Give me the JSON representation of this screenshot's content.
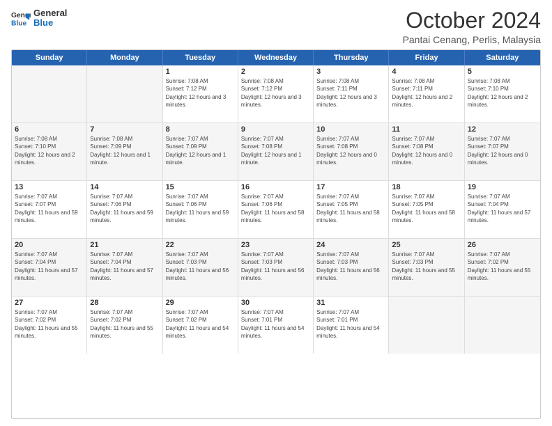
{
  "logo": {
    "general": "General",
    "blue": "Blue"
  },
  "title": "October 2024",
  "location": "Pantai Cenang, Perlis, Malaysia",
  "header_days": [
    "Sunday",
    "Monday",
    "Tuesday",
    "Wednesday",
    "Thursday",
    "Friday",
    "Saturday"
  ],
  "weeks": [
    [
      {
        "date": "",
        "info": ""
      },
      {
        "date": "",
        "info": ""
      },
      {
        "date": "1",
        "sunrise": "Sunrise: 7:08 AM",
        "sunset": "Sunset: 7:12 PM",
        "daylight": "Daylight: 12 hours and 3 minutes."
      },
      {
        "date": "2",
        "sunrise": "Sunrise: 7:08 AM",
        "sunset": "Sunset: 7:12 PM",
        "daylight": "Daylight: 12 hours and 3 minutes."
      },
      {
        "date": "3",
        "sunrise": "Sunrise: 7:08 AM",
        "sunset": "Sunset: 7:11 PM",
        "daylight": "Daylight: 12 hours and 3 minutes."
      },
      {
        "date": "4",
        "sunrise": "Sunrise: 7:08 AM",
        "sunset": "Sunset: 7:11 PM",
        "daylight": "Daylight: 12 hours and 2 minutes."
      },
      {
        "date": "5",
        "sunrise": "Sunrise: 7:08 AM",
        "sunset": "Sunset: 7:10 PM",
        "daylight": "Daylight: 12 hours and 2 minutes."
      }
    ],
    [
      {
        "date": "6",
        "sunrise": "Sunrise: 7:08 AM",
        "sunset": "Sunset: 7:10 PM",
        "daylight": "Daylight: 12 hours and 2 minutes."
      },
      {
        "date": "7",
        "sunrise": "Sunrise: 7:08 AM",
        "sunset": "Sunset: 7:09 PM",
        "daylight": "Daylight: 12 hours and 1 minute."
      },
      {
        "date": "8",
        "sunrise": "Sunrise: 7:07 AM",
        "sunset": "Sunset: 7:09 PM",
        "daylight": "Daylight: 12 hours and 1 minute."
      },
      {
        "date": "9",
        "sunrise": "Sunrise: 7:07 AM",
        "sunset": "Sunset: 7:08 PM",
        "daylight": "Daylight: 12 hours and 1 minute."
      },
      {
        "date": "10",
        "sunrise": "Sunrise: 7:07 AM",
        "sunset": "Sunset: 7:08 PM",
        "daylight": "Daylight: 12 hours and 0 minutes."
      },
      {
        "date": "11",
        "sunrise": "Sunrise: 7:07 AM",
        "sunset": "Sunset: 7:08 PM",
        "daylight": "Daylight: 12 hours and 0 minutes."
      },
      {
        "date": "12",
        "sunrise": "Sunrise: 7:07 AM",
        "sunset": "Sunset: 7:07 PM",
        "daylight": "Daylight: 12 hours and 0 minutes."
      }
    ],
    [
      {
        "date": "13",
        "sunrise": "Sunrise: 7:07 AM",
        "sunset": "Sunset: 7:07 PM",
        "daylight": "Daylight: 11 hours and 59 minutes."
      },
      {
        "date": "14",
        "sunrise": "Sunrise: 7:07 AM",
        "sunset": "Sunset: 7:06 PM",
        "daylight": "Daylight: 11 hours and 59 minutes."
      },
      {
        "date": "15",
        "sunrise": "Sunrise: 7:07 AM",
        "sunset": "Sunset: 7:06 PM",
        "daylight": "Daylight: 11 hours and 59 minutes."
      },
      {
        "date": "16",
        "sunrise": "Sunrise: 7:07 AM",
        "sunset": "Sunset: 7:06 PM",
        "daylight": "Daylight: 11 hours and 58 minutes."
      },
      {
        "date": "17",
        "sunrise": "Sunrise: 7:07 AM",
        "sunset": "Sunset: 7:05 PM",
        "daylight": "Daylight: 11 hours and 58 minutes."
      },
      {
        "date": "18",
        "sunrise": "Sunrise: 7:07 AM",
        "sunset": "Sunset: 7:05 PM",
        "daylight": "Daylight: 11 hours and 58 minutes."
      },
      {
        "date": "19",
        "sunrise": "Sunrise: 7:07 AM",
        "sunset": "Sunset: 7:04 PM",
        "daylight": "Daylight: 11 hours and 57 minutes."
      }
    ],
    [
      {
        "date": "20",
        "sunrise": "Sunrise: 7:07 AM",
        "sunset": "Sunset: 7:04 PM",
        "daylight": "Daylight: 11 hours and 57 minutes."
      },
      {
        "date": "21",
        "sunrise": "Sunrise: 7:07 AM",
        "sunset": "Sunset: 7:04 PM",
        "daylight": "Daylight: 11 hours and 57 minutes."
      },
      {
        "date": "22",
        "sunrise": "Sunrise: 7:07 AM",
        "sunset": "Sunset: 7:03 PM",
        "daylight": "Daylight: 11 hours and 56 minutes."
      },
      {
        "date": "23",
        "sunrise": "Sunrise: 7:07 AM",
        "sunset": "Sunset: 7:03 PM",
        "daylight": "Daylight: 11 hours and 56 minutes."
      },
      {
        "date": "24",
        "sunrise": "Sunrise: 7:07 AM",
        "sunset": "Sunset: 7:03 PM",
        "daylight": "Daylight: 11 hours and 56 minutes."
      },
      {
        "date": "25",
        "sunrise": "Sunrise: 7:07 AM",
        "sunset": "Sunset: 7:03 PM",
        "daylight": "Daylight: 11 hours and 55 minutes."
      },
      {
        "date": "26",
        "sunrise": "Sunrise: 7:07 AM",
        "sunset": "Sunset: 7:02 PM",
        "daylight": "Daylight: 11 hours and 55 minutes."
      }
    ],
    [
      {
        "date": "27",
        "sunrise": "Sunrise: 7:07 AM",
        "sunset": "Sunset: 7:02 PM",
        "daylight": "Daylight: 11 hours and 55 minutes."
      },
      {
        "date": "28",
        "sunrise": "Sunrise: 7:07 AM",
        "sunset": "Sunset: 7:02 PM",
        "daylight": "Daylight: 11 hours and 55 minutes."
      },
      {
        "date": "29",
        "sunrise": "Sunrise: 7:07 AM",
        "sunset": "Sunset: 7:02 PM",
        "daylight": "Daylight: 11 hours and 54 minutes."
      },
      {
        "date": "30",
        "sunrise": "Sunrise: 7:07 AM",
        "sunset": "Sunset: 7:01 PM",
        "daylight": "Daylight: 11 hours and 54 minutes."
      },
      {
        "date": "31",
        "sunrise": "Sunrise: 7:07 AM",
        "sunset": "Sunset: 7:01 PM",
        "daylight": "Daylight: 11 hours and 54 minutes."
      },
      {
        "date": "",
        "info": ""
      },
      {
        "date": "",
        "info": ""
      }
    ]
  ]
}
